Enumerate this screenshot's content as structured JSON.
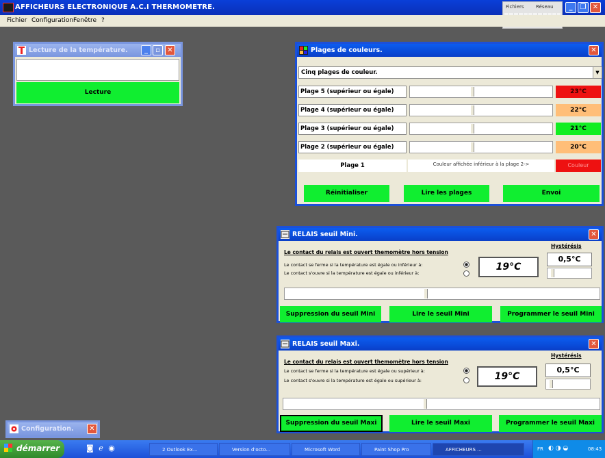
{
  "app": {
    "title": "AFFICHEURS ELECTRONIQUE A.C.I  THERMOMETRE."
  },
  "menu": [
    "Fichier",
    "Configuration",
    "Fenêtre",
    "?"
  ],
  "file_tabs": [
    "Fichiers",
    "Réseau"
  ],
  "lecture_window": {
    "title": "Lecture de la température.",
    "value": "",
    "button": "Lecture"
  },
  "plages_window": {
    "title": "Plages de couleurs.",
    "select_value": "Cinq plages de couleur.",
    "rows": [
      {
        "label": "Plage 5 (supérieur ou égale)",
        "value": "23°C",
        "color": "#ee1111",
        "text_color": "#330000",
        "slider": 0.18
      },
      {
        "label": "Plage 4 (supérieur ou égale)",
        "value": "22°C",
        "color": "#ffbe78",
        "text_color": "#000000",
        "slider": 0.18
      },
      {
        "label": "Plage 3 (supérieur ou égale)",
        "value": "21°C",
        "color": "#11ee22",
        "text_color": "#000000",
        "slider": 0.18
      },
      {
        "label": "Plage 2 (supérieur ou égale)",
        "value": "20°C",
        "color": "#ffbe78",
        "text_color": "#000000",
        "slider": 0.18
      }
    ],
    "plage1": {
      "label": "Plage 1",
      "description": "Couleur affichée inférieur à la plage 2->",
      "swatch": "Couleur",
      "color": "#ee1111"
    },
    "buttons": [
      "Réinitialiser",
      "Lire les plages",
      "Envoi"
    ]
  },
  "relais_mini": {
    "title": "RELAIS seuil Mini.",
    "heading": "Le contact du relais est ouvert themomètre hors tension",
    "hysteresis_label": "Hystérésis",
    "hysteresis_value": "0,5°C",
    "line1": "Le contact se ferme si la température est égale ou inférieur à:",
    "line2": "Le contact s'ouvre si la température est égale ou inférieur à:",
    "selected": 1,
    "temperature": "19°C",
    "slider": 0.44,
    "buttons": [
      "Suppression du seuil Mini",
      "Lire le seuil Mini",
      "Programmer le seuil Mini"
    ]
  },
  "relais_maxi": {
    "title": "RELAIS seuil Maxi.",
    "heading": "Le contact du relais est ouvert themomètre hors tension",
    "hysteresis_label": "Hystérésis",
    "hysteresis_value": "0,5°C",
    "line1": "Le contact se ferme si la température est égale ou supérieur à:",
    "line2": "Le contact s'ouvre si la température est égale ou supérieur à:",
    "selected": 1,
    "temperature": "19°C",
    "slider": 0.44,
    "buttons": [
      "Suppression du seuil Maxi",
      "Lire le seuil Maxi",
      "Programmer le seuil Maxi"
    ]
  },
  "config_window": {
    "title": "Configuration."
  },
  "taskbar": {
    "start": "démarrer",
    "items": [
      "2 Outlook Ex...",
      "Version d'octo...",
      "Microsoft Word",
      "Paint Shop Pro",
      "AFFICHEURS ..."
    ],
    "tray_lang": "FR",
    "clock": "08:43"
  }
}
